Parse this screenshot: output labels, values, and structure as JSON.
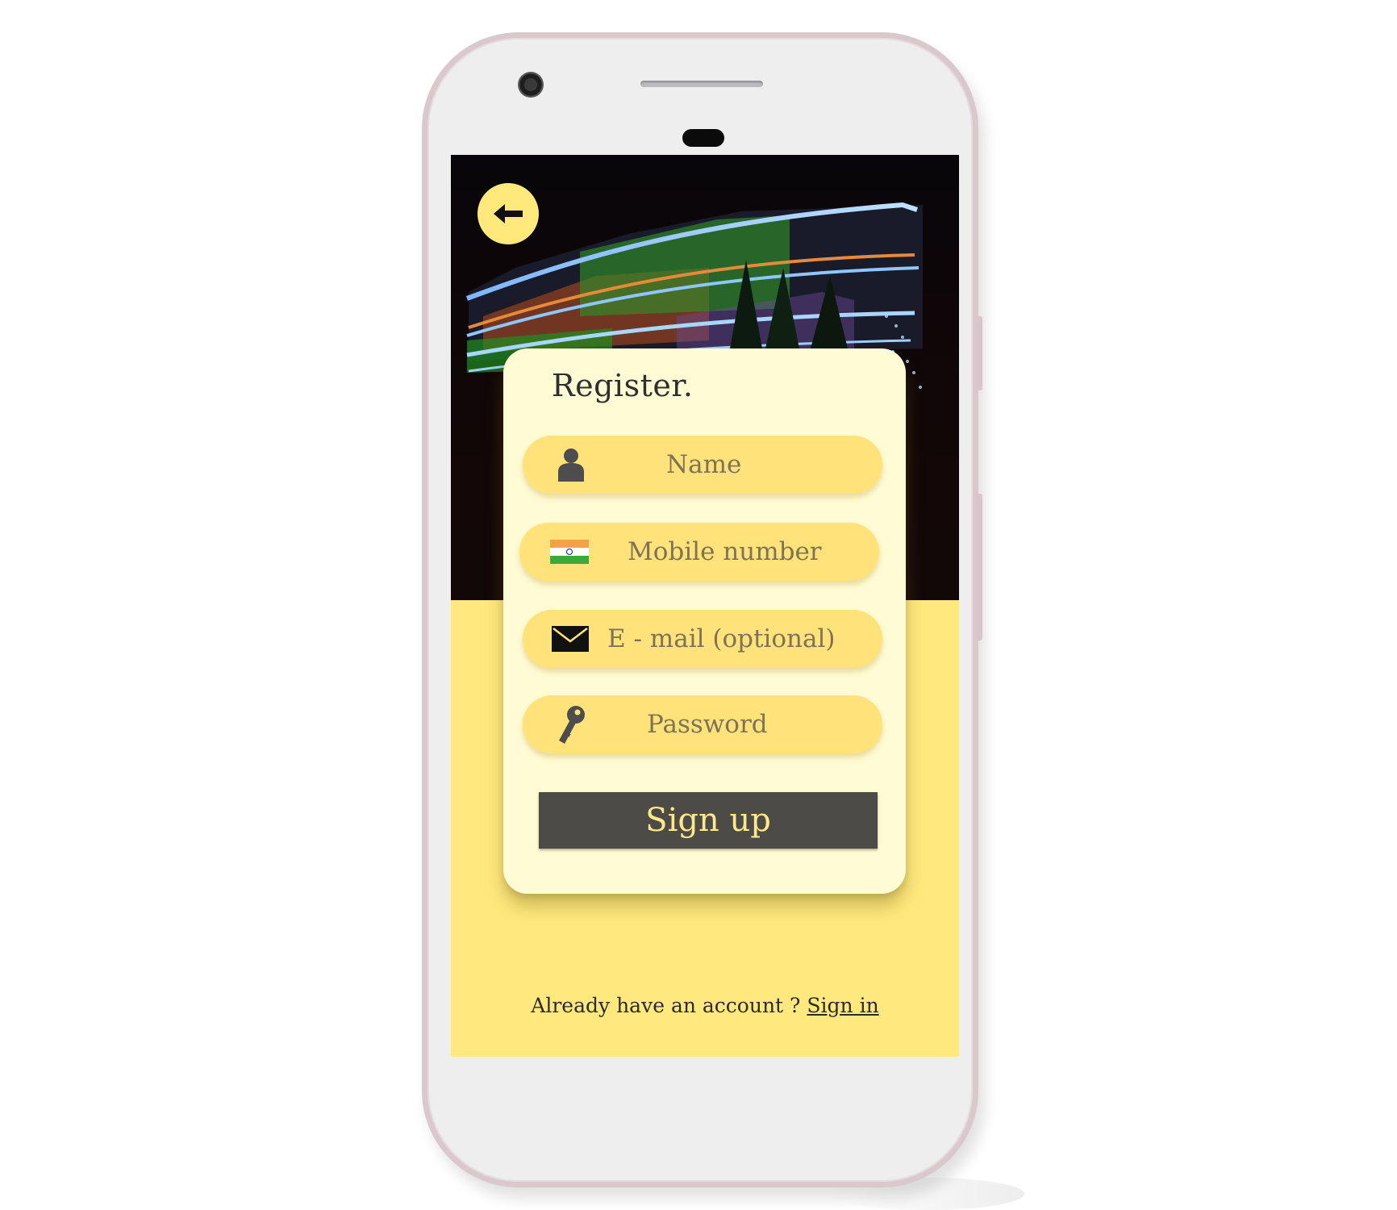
{
  "colors": {
    "accent": "#ffe97e",
    "field": "#ffe279",
    "card": "#fffbd4",
    "button": "#4c4b48",
    "button_text": "#ffe987"
  },
  "header": {
    "back_icon": "arrow-left-icon"
  },
  "form": {
    "title": "Register.",
    "fields": [
      {
        "icon": "person-icon",
        "placeholder": "Name"
      },
      {
        "icon": "india-flag-icon",
        "placeholder": "Mobile number"
      },
      {
        "icon": "envelope-icon",
        "placeholder": "E - mail (optional)"
      },
      {
        "icon": "key-icon",
        "placeholder": "Password"
      }
    ],
    "submit_label": "Sign up"
  },
  "footer": {
    "prompt": "Already have an account ? ",
    "link_label": "Sign in"
  }
}
